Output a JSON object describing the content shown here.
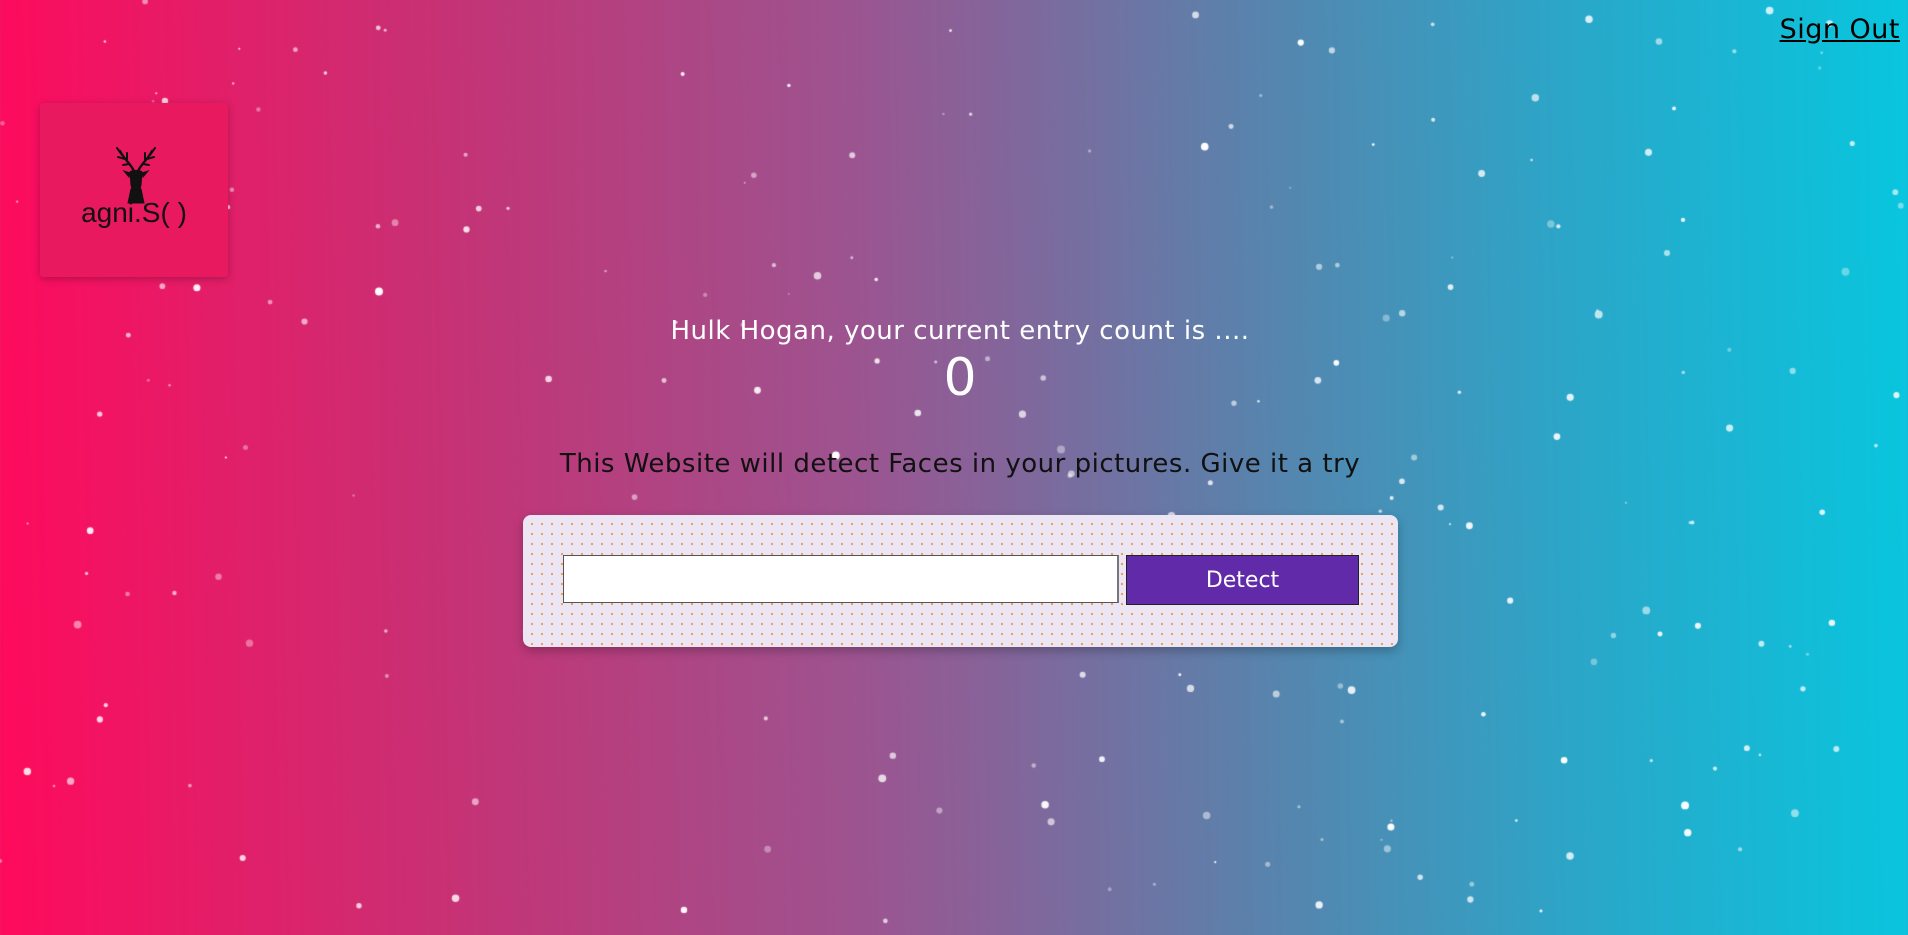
{
  "header": {
    "signout_label": "Sign Out"
  },
  "logo": {
    "text": "agni.S( )",
    "icon": "deer-head-icon"
  },
  "main": {
    "greeting": "Hulk Hogan, your current entry count is ....",
    "entry_count": "0",
    "tagline": "This Website will detect Faces in your pictures. Give it a try"
  },
  "form": {
    "input_value": "",
    "input_placeholder": "",
    "detect_label": "Detect"
  },
  "colors": {
    "gradient_start": "#ff0a5c",
    "gradient_end": "#08c6de",
    "button_bg": "#612aa8",
    "panel_bg": "#ece6f4",
    "panel_dots": "#f19a4b",
    "logo_bg": "#e8195f"
  }
}
